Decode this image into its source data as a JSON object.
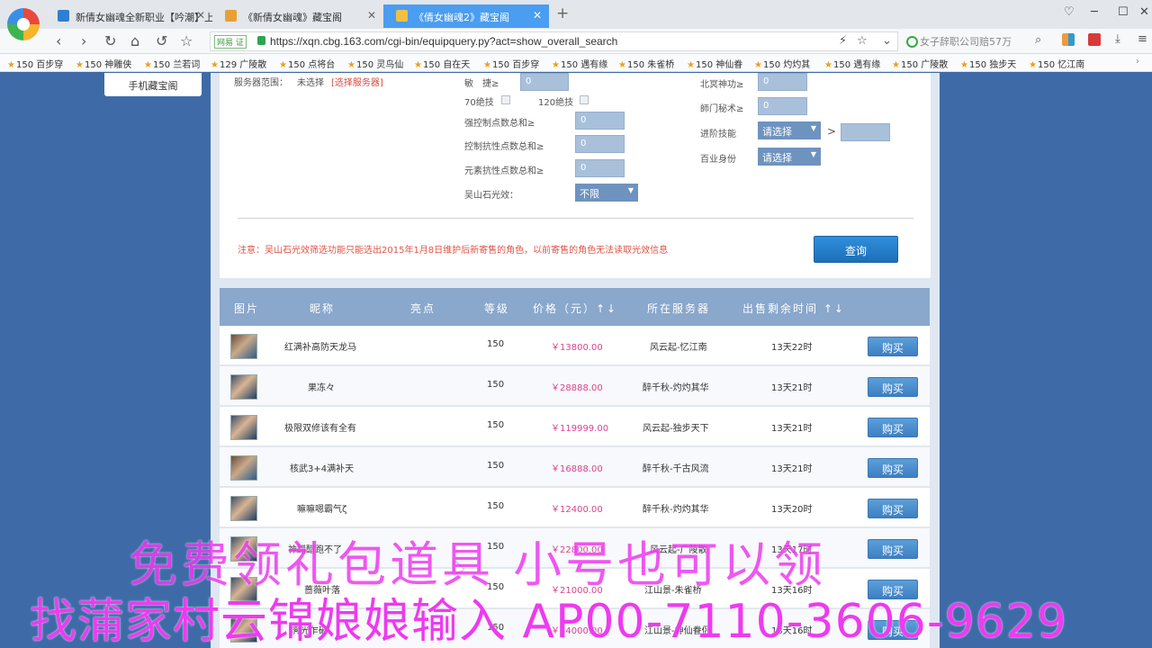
{
  "browser": {
    "tabs": [
      {
        "title": "新倩女幽魂全新职业【吟潮】上线",
        "active": false
      },
      {
        "title": "《新倩女幽魂》藏宝阁",
        "active": false
      },
      {
        "title": "《倩女幽魂2》藏宝阁",
        "active": true
      }
    ],
    "url_badge": "网易 证",
    "url": "https://xqn.cbg.163.com/cgi-bin/equipquery.py?act=show_overall_search",
    "search_hint": "女子辞职公司赔57万",
    "bookmarks": [
      "150 百步穿",
      "150 神雕侠",
      "150 兰若词",
      "129 广陵散",
      "150 点将台",
      "150 灵鸟仙",
      "150 自在天",
      "150 百步穿",
      "150 遇有缘",
      "150 朱雀桥",
      "150 神仙眷",
      "150 灼灼其",
      "150 遇有缘",
      "150 广陵散",
      "150 独步天",
      "150 忆江南"
    ]
  },
  "page": {
    "mobile_link": "手机藏宝阁",
    "filters": {
      "server_range_label": "服务器范围：",
      "server_range_value": "未选择",
      "server_select_link": "[选择服务器]",
      "agility_label": "敏　捷≥",
      "agility_value": "0",
      "skill70_label": "70绝技",
      "skill120_label": "120绝技",
      "strong_control_label": "强控制点数总和≥",
      "strong_control_value": "0",
      "control_resist_label": "控制抗性点数总和≥",
      "control_resist_value": "0",
      "element_resist_label": "元素抗性点数总和≥",
      "element_resist_value": "0",
      "wushan_label": "吴山石光效：",
      "wushan_value": "不限",
      "beiming_label": "北冥神功≥",
      "beiming_value": "0",
      "school_secret_label": "師门秘术≥",
      "school_secret_value": "0",
      "advanced_skill_label": "进阶技能",
      "advanced_skill_value": "请选择",
      "gt_sign": ">",
      "profession_label": "百业身份",
      "profession_value": "请选择"
    },
    "note": "注意：吴山石光效筛选功能只能选出2015年1月8日维护后新寄售的角色，以前寄售的角色无法读取光效信息",
    "query_button": "查询",
    "table": {
      "headers": [
        "图片",
        "昵称",
        "亮点",
        "等级",
        "价格（元）↑↓",
        "所在服务器",
        "出售剩余时间 ↑↓"
      ],
      "rows": [
        {
          "name": "红满补高防天龙马",
          "level": "150",
          "price": "￥13800.00",
          "server": "风云起-忆江南",
          "time": "13天22时",
          "buy": "购买"
        },
        {
          "name": "果冻々",
          "level": "150",
          "price": "￥28888.00",
          "server": "醉千秋-灼灼其华",
          "time": "13天21时",
          "buy": "购买"
        },
        {
          "name": "极限双修该有全有",
          "level": "150",
          "price": "￥119999.00",
          "server": "风云起-独步天下",
          "time": "13天21时",
          "buy": "购买"
        },
        {
          "name": "核武3+4满补天",
          "level": "150",
          "price": "￥16888.00",
          "server": "醉千秋-千古风流",
          "time": "13天21时",
          "buy": "购买"
        },
        {
          "name": "嘛嘛嗯霸气ζ",
          "level": "150",
          "price": "￥12400.00",
          "server": "醉千秋-灼灼其华",
          "time": "13天20时",
          "buy": "购买"
        },
        {
          "name": "神醋醋跑不了",
          "level": "150",
          "price": "￥22800.00",
          "server": "风云起-广陵散",
          "time": "13天17时",
          "buy": "购买"
        },
        {
          "name": "蔷薇叶落",
          "level": "150",
          "price": "￥21000.00",
          "server": "江山景-朱雀桥",
          "time": "13天16时",
          "buy": "购买"
        },
        {
          "name": "霁光乍破",
          "level": "150",
          "price": "￥34000.00",
          "server": "江山景-神仙眷侣",
          "time": "13天16时",
          "buy": "购买"
        }
      ]
    }
  },
  "overlay": {
    "line1": "免费领礼包道具 小号也可以领",
    "line2": "找蒲家村云锦娘娘输入 AP00-7110-3606-9629"
  }
}
